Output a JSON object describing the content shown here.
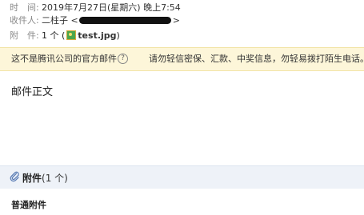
{
  "header": {
    "time_label": "时　间:",
    "time_value": "2019年7月27日(星期六) 晚上7:54",
    "to_label": "收件人:",
    "to_name": "二柱子 <",
    "to_suffix": ">",
    "attach_label": "附　件:",
    "attach_count_prefix": "1 个 (",
    "attach_file": "test.jpg",
    "attach_count_suffix": ")"
  },
  "notice": {
    "official": "这不是腾讯公司的官方邮件",
    "help_icon": "?",
    "warning": "请勿轻信密保、汇款、中奖信息，勿轻易拨打陌生电话。"
  },
  "body": {
    "text": "邮件正文"
  },
  "attachments": {
    "title": "附件",
    "count": "(1 个)",
    "section_title": "普通附件"
  },
  "colors": {
    "notice_bg": "#fdf6d9",
    "attach_bar_bg": "#eef2f8"
  }
}
